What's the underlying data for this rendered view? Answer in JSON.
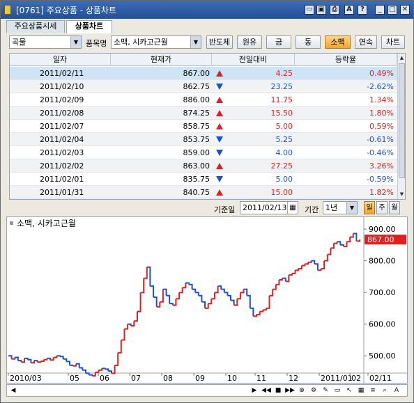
{
  "window": {
    "title": "[0761] 주요상품 - 상품차트",
    "title_buttons": [
      "calculator-icon",
      "window-icon",
      "print-icon",
      "font-icon",
      "help-icon",
      "minimize-icon",
      "maximize-icon",
      "close-icon"
    ],
    "title_button_glyphs": [
      "▭",
      "▣",
      "⎙",
      "A",
      "?",
      "_",
      "□",
      "✕"
    ]
  },
  "tabs": [
    {
      "label": "주요상품시세",
      "active": false
    },
    {
      "label": "상품차트",
      "active": true
    }
  ],
  "toolbar": {
    "category": "곡물",
    "item_label": "품목명",
    "item_value": "소맥, 시카고근월",
    "buttons": [
      {
        "label": "반도체",
        "active": false
      },
      {
        "label": "원유",
        "active": false
      },
      {
        "label": "금",
        "active": false
      },
      {
        "label": "동",
        "active": false
      },
      {
        "label": "소맥",
        "active": true
      },
      {
        "label": "연속",
        "active": false
      },
      {
        "label": "차트",
        "active": false
      }
    ]
  },
  "table": {
    "headers": [
      "일자",
      "현재가",
      "전일대비",
      "등락율"
    ],
    "rows": [
      {
        "date": "2011/02/11",
        "price": "867.00",
        "dir": "up",
        "change": "4.25",
        "rate": "0.49%"
      },
      {
        "date": "2011/02/10",
        "price": "862.75",
        "dir": "down",
        "change": "23.25",
        "rate": "-2.62%"
      },
      {
        "date": "2011/02/09",
        "price": "886.00",
        "dir": "up",
        "change": "11.75",
        "rate": "1.34%"
      },
      {
        "date": "2011/02/08",
        "price": "874.25",
        "dir": "up",
        "change": "15.50",
        "rate": "1.80%"
      },
      {
        "date": "2011/02/07",
        "price": "858.75",
        "dir": "up",
        "change": "5.00",
        "rate": "0.59%"
      },
      {
        "date": "2011/02/04",
        "price": "853.75",
        "dir": "down",
        "change": "5.25",
        "rate": "-0.61%"
      },
      {
        "date": "2011/02/03",
        "price": "859.00",
        "dir": "down",
        "change": "4.00",
        "rate": "-0.46%"
      },
      {
        "date": "2011/02/02",
        "price": "863.00",
        "dir": "up",
        "change": "27.25",
        "rate": "3.26%"
      },
      {
        "date": "2011/02/01",
        "price": "835.75",
        "dir": "down",
        "change": "5.00",
        "rate": "-0.59%"
      },
      {
        "date": "2011/01/31",
        "price": "840.75",
        "dir": "up",
        "change": "15.00",
        "rate": "1.82%"
      }
    ]
  },
  "controls": {
    "base_date_label": "기준일",
    "base_date": "2011/02/13",
    "period_label": "기간",
    "period": "1년",
    "period_buttons": [
      {
        "label": "일",
        "active": true
      },
      {
        "label": "주",
        "active": false
      },
      {
        "label": "월",
        "active": false
      }
    ]
  },
  "colors": {
    "up": "#e02020",
    "down": "#1a52c8",
    "accent": "#f0a52d",
    "title": "#2b5aa3"
  },
  "chart_data": {
    "type": "line",
    "title": "소맥, 시카고근월",
    "ylim": [
      450,
      920
    ],
    "yticks": [
      "900.00",
      "800.00",
      "700.00",
      "600.00",
      "500.00"
    ],
    "ytick_values": [
      900,
      800,
      700,
      600,
      500
    ],
    "current_value_label": "867.00",
    "current_value": 867,
    "xticks": [
      "2010/03",
      "05",
      "06",
      "07",
      "08",
      "09",
      "10",
      "11",
      "12",
      "2011/01",
      "02",
      "02/11"
    ],
    "series": [
      {
        "values": [
          500,
          490,
          495,
          485,
          480,
          492,
          488,
          478,
          485,
          480,
          483,
          488,
          492,
          487,
          495,
          500,
          498,
          490,
          482,
          470,
          468,
          475,
          462,
          455,
          445,
          440,
          437,
          448,
          455,
          460,
          458,
          452,
          445,
          470,
          510,
          550,
          585,
          600,
          595,
          610,
          640,
          700,
          745,
          780,
          720,
          685,
          655,
          670,
          710,
          690,
          665,
          660,
          680,
          700,
          715,
          730,
          725,
          710,
          700,
          690,
          670,
          650,
          665,
          680,
          700,
          720,
          710,
          700,
          690,
          675,
          660,
          680,
          700,
          710,
          690,
          650,
          625,
          630,
          640,
          645,
          650,
          690,
          710,
          725,
          740,
          745,
          735,
          755,
          760,
          770,
          775,
          785,
          790,
          795,
          800,
          790,
          770,
          775,
          800,
          820,
          840,
          855,
          860,
          850,
          845,
          860,
          875,
          886,
          862,
          867
        ],
        "up_color": "#e02020",
        "down_color": "#1a52c8"
      }
    ]
  },
  "bottom_bar": {
    "icons": [
      "scroll-left-icon",
      "play-icon",
      "rewind-icon",
      "stop-icon",
      "forward-icon",
      "zoom-in-icon",
      "settings-icon",
      "tool-icon",
      "window-icon",
      "arrow-icon",
      "grid-icon",
      "list-icon",
      "zoom-icon",
      "text-icon"
    ],
    "glyphs": [
      "◀",
      "▶",
      "◀◀",
      "■",
      "▶▶",
      "⊕",
      "⚙",
      "✎",
      "▭",
      "↖",
      "▦",
      "≡",
      "⌕",
      "A"
    ]
  }
}
